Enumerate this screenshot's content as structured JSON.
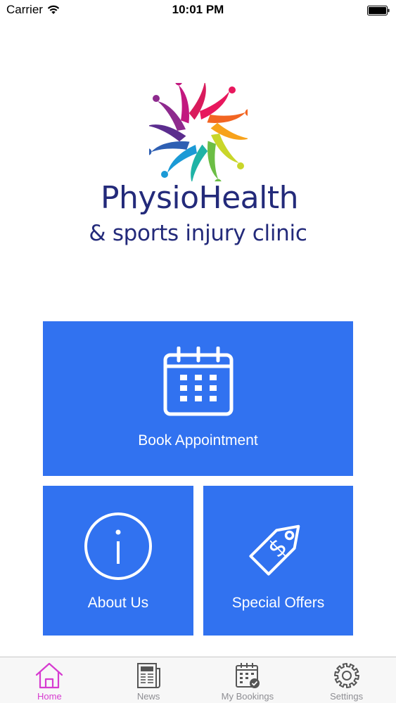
{
  "status_bar": {
    "carrier": "Carrier",
    "time": "10:01 PM"
  },
  "logo": {
    "title": "PhysioHealth",
    "subtitle": "& sports injury clinic",
    "brand_color": "#232a7a"
  },
  "tiles": {
    "book": {
      "label": "Book Appointment",
      "icon": "calendar-icon"
    },
    "about": {
      "label": "About Us",
      "icon": "info-icon"
    },
    "offers": {
      "label": "Special Offers",
      "icon": "price-tag-icon"
    },
    "color": "#3172f0"
  },
  "tab_bar": {
    "active_color": "#d63bd0",
    "inactive_color": "#8e8e93",
    "tabs": [
      {
        "label": "Home",
        "icon": "home-icon",
        "active": true
      },
      {
        "label": "News",
        "icon": "newspaper-icon",
        "active": false
      },
      {
        "label": "My Bookings",
        "icon": "calendar-check-icon",
        "active": false
      },
      {
        "label": "Settings",
        "icon": "gear-icon",
        "active": false
      }
    ]
  }
}
